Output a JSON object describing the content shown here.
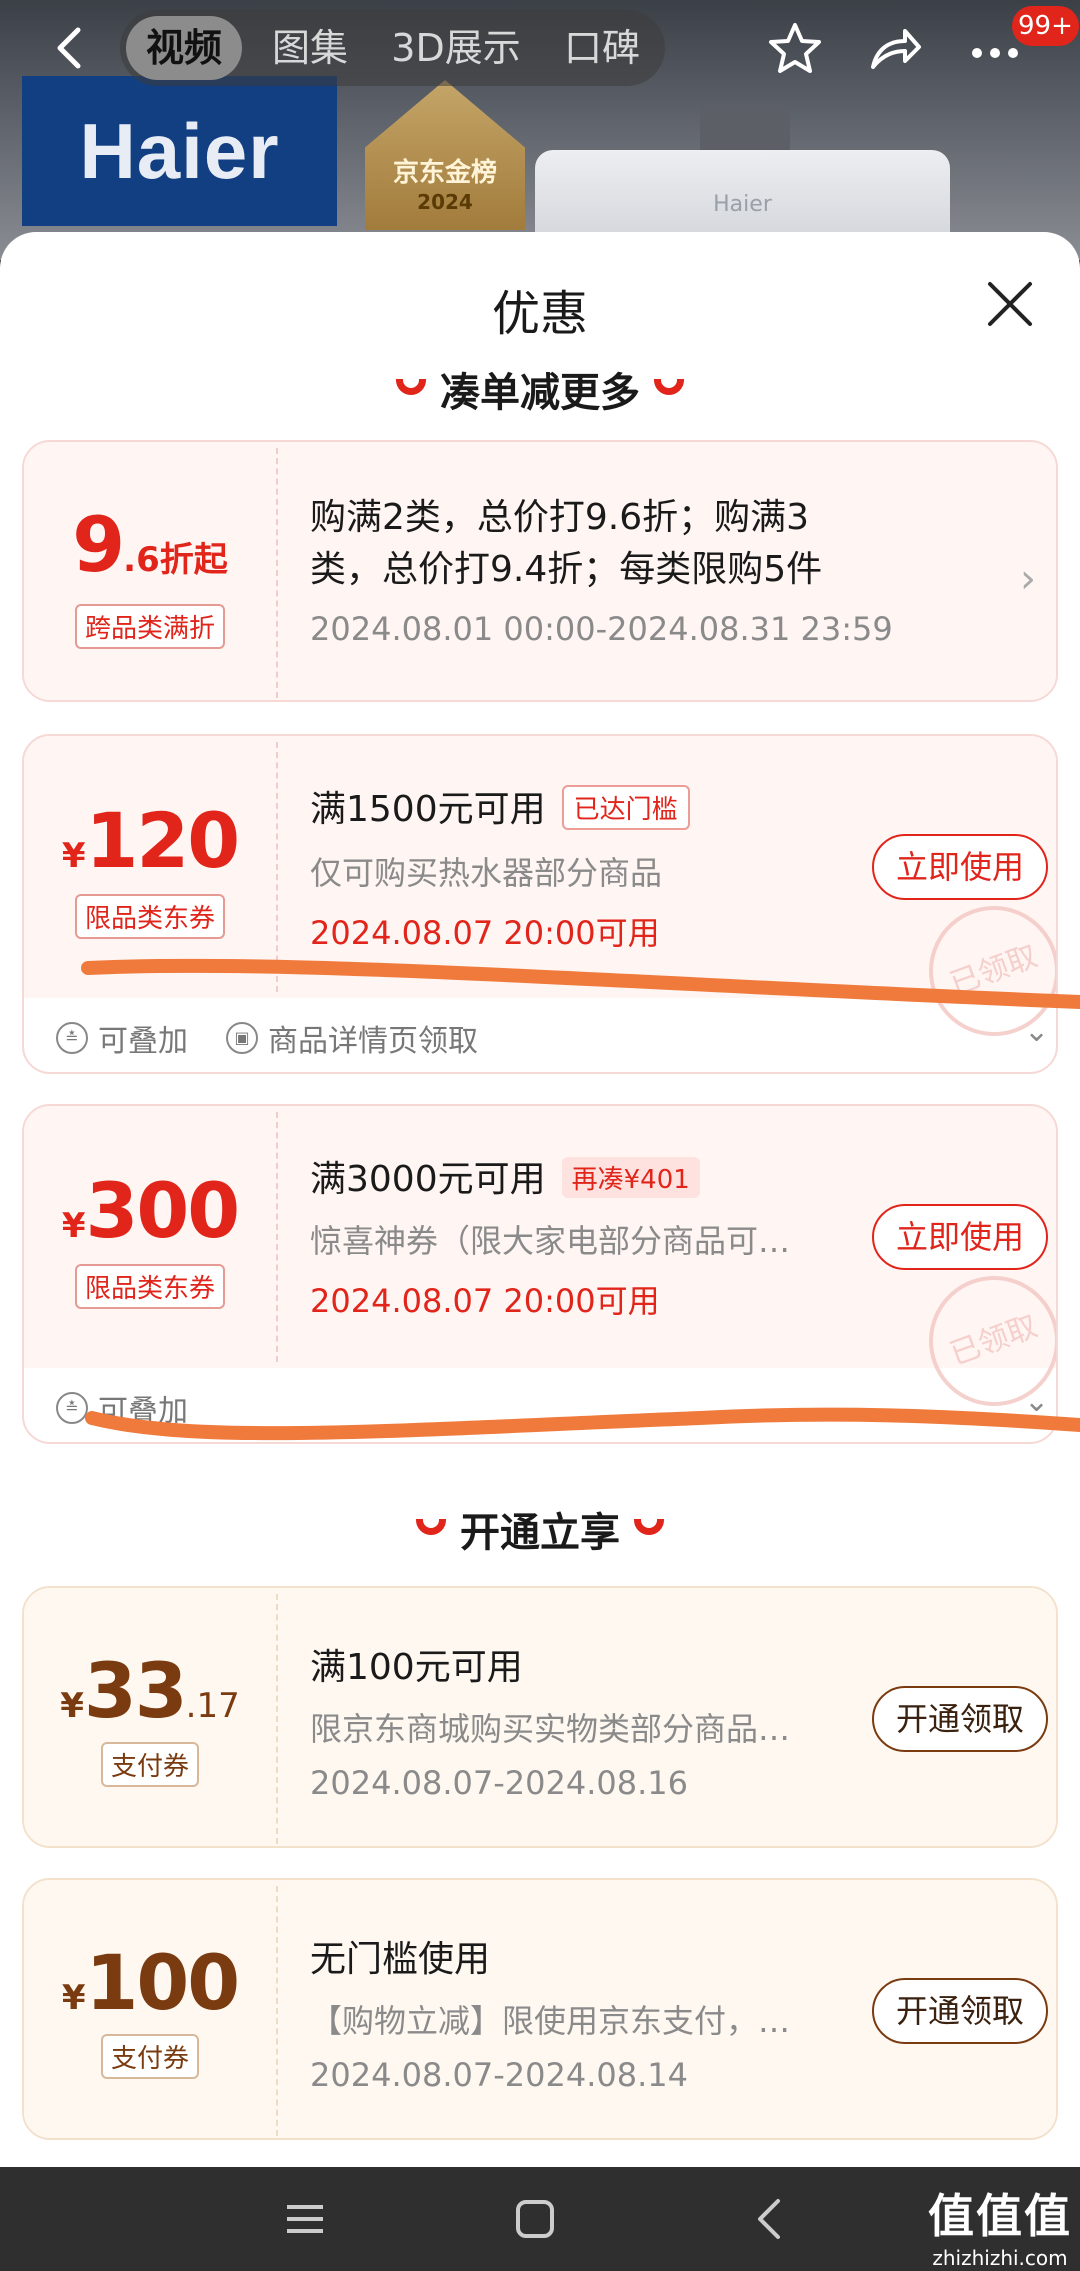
{
  "header": {
    "tabs": [
      {
        "label": "视频",
        "active": true
      },
      {
        "label": "图集",
        "active": false
      },
      {
        "label": "3D展示",
        "active": false
      },
      {
        "label": "口碑",
        "active": false
      }
    ],
    "message_badge": "99+",
    "icons": [
      "back-icon",
      "star-icon",
      "share-icon",
      "more-icon"
    ]
  },
  "hero": {
    "brand_logo": "Haier",
    "badge_title": "京东金榜",
    "badge_year": "2024",
    "device_brand": "Haier"
  },
  "sheet": {
    "title": "优惠",
    "section1": "凑单减更多",
    "section2": "开通立享"
  },
  "cards": [
    {
      "amount": "9",
      "amount_small": ".6折起",
      "tag": "跨品类满折",
      "line1": "购满2类，总价打9.6折；购满3",
      "line1b": "类，总价打9.4折；每类限购5件",
      "line3": "2024.08.01 00:00-2024.08.31 23:59"
    },
    {
      "currency": "¥",
      "amount": "120",
      "tag": "限品类东券",
      "line1": "满1500元可用",
      "badge": "已达门槛",
      "line2": "仅可购买热水器部分商品",
      "line3": "2024.08.07 20:00可用",
      "button": "立即使用",
      "stamp": "已领取",
      "foot1": "可叠加",
      "foot2": "商品详情页领取"
    },
    {
      "currency": "¥",
      "amount": "300",
      "tag": "限品类东券",
      "line1": "满3000元可用",
      "badge": "再凑¥401",
      "line2": "惊喜神券（限大家电部分商品可…",
      "line3": "2024.08.07 20:00可用",
      "button": "立即使用",
      "stamp": "已领取",
      "foot1": "可叠加"
    },
    {
      "currency": "¥",
      "amount": "33",
      "amount_small": ".17",
      "tag": "支付券",
      "line1": "满100元可用",
      "line2": "限京东商城购买实物类部分商品…",
      "line3": "2024.08.07-2024.08.16",
      "button": "开通领取"
    },
    {
      "currency": "¥",
      "amount": "100",
      "tag": "支付券",
      "line1": "无门槛使用",
      "line2": "【购物立减】限使用京东支付，…",
      "line3": "2024.08.07-2024.08.14",
      "button": "开通领取"
    }
  ],
  "watermark": {
    "big": "值值值",
    "small": "zhizhizhi.com"
  },
  "colors": {
    "accent": "#e1251b",
    "pay_brown": "#7a3b10",
    "scribble": "#f07a3c"
  }
}
